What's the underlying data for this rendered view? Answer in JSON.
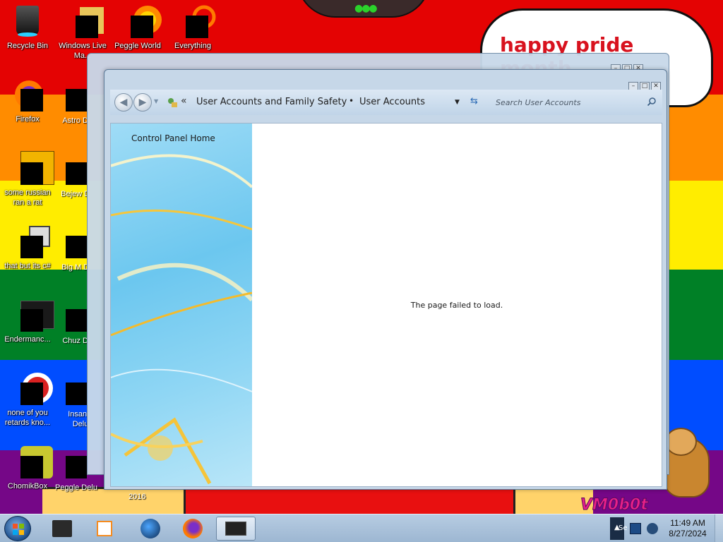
{
  "desktop": {
    "banner_text": "happy pride month",
    "watermark": "VM0b0t",
    "icons": [
      {
        "label": "Recycle Bin"
      },
      {
        "label": "Windows Live Ma..."
      },
      {
        "label": "Peggle World"
      },
      {
        "label": "Everything"
      },
      {
        "label": "Firefox"
      },
      {
        "label": "Astro Delu"
      },
      {
        "label": "some russian ran a rat"
      },
      {
        "label": "Bejew Delu"
      },
      {
        "label": "that but its c#"
      },
      {
        "label": "Big M Delu"
      },
      {
        "label": "Endermanc..."
      },
      {
        "label": "Chuz Delu"
      },
      {
        "label": "none of you retards kno..."
      },
      {
        "label": "Insaniq Delu"
      },
      {
        "label": "ChomikBox"
      },
      {
        "label": "Peggle Delu"
      }
    ],
    "extra_label": "2016"
  },
  "window": {
    "breadcrumb_root": "User Accounts and Family Safety",
    "breadcrumb_sep": "•",
    "breadcrumb_current": "User Accounts",
    "breadcrumb_chevron": "«",
    "search_placeholder": "Search User Accounts",
    "sidebar_link": "Control Panel Home",
    "error_message": "The page failed to load.",
    "controls": {
      "minimize": "–",
      "maximize": "□",
      "close": "✕"
    }
  },
  "taskbar": {
    "clock_time": "11:49 AM",
    "clock_date": "8/27/2024",
    "tray_partial": "Se"
  },
  "colors": {
    "flag_red": "#e40303",
    "flag_orange": "#ff8c00",
    "flag_yellow": "#ffed00",
    "flag_green": "#008026",
    "flag_blue": "#004dff",
    "flag_violet": "#750787",
    "banner_text": "#d8121e"
  }
}
